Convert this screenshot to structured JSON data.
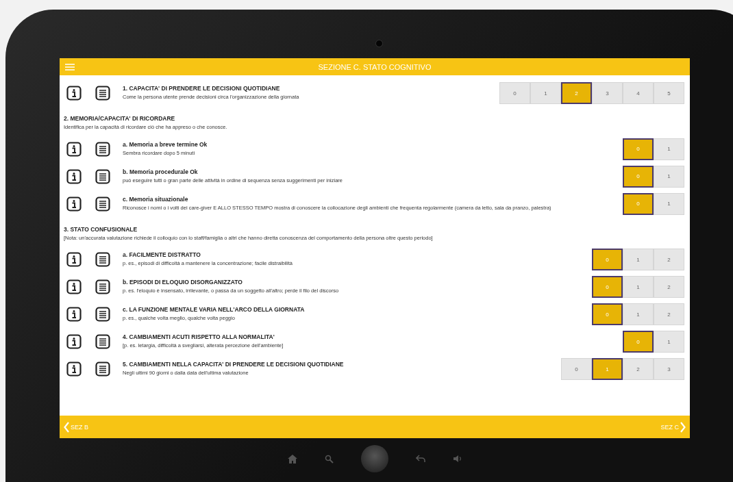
{
  "header": {
    "title": "SEZIONE C. STATO COGNITIVO"
  },
  "items": [
    {
      "kind": "question",
      "title": "1. CAPACITA' DI PRENDERE LE DECISIONI QUOTIDIANE",
      "description": "Come la persona utente prende decisioni circa l'organizzazione della giornata",
      "options": [
        {
          "label": "0",
          "selected": false
        },
        {
          "label": "1",
          "selected": false
        },
        {
          "label": "2",
          "selected": true
        },
        {
          "label": "3",
          "selected": false
        },
        {
          "label": "4",
          "selected": false
        },
        {
          "label": "5",
          "selected": false
        }
      ]
    },
    {
      "kind": "heading",
      "title": "2. MEMORIA/CAPACITA' DI RICORDARE",
      "description": "Identifica per la capacità di ricordare ciò che ha appreso o che conosce."
    },
    {
      "kind": "question",
      "title": "a. Memoria a breve termine Ok",
      "description": "Sembra ricordare dopo 5 minuti",
      "options": [
        {
          "label": "0",
          "selected": true
        },
        {
          "label": "1",
          "selected": false
        }
      ]
    },
    {
      "kind": "question",
      "title": "b. Memoria procedurale Ok",
      "description": "può eseguire tutti o gran parte delle attività in ordine di sequenza senza suggerimenti per iniziare",
      "options": [
        {
          "label": "0",
          "selected": true
        },
        {
          "label": "1",
          "selected": false
        }
      ]
    },
    {
      "kind": "question",
      "title": "c. Memoria situazionale",
      "description": "Riconosce i nomi o i volti dei care-giver E ALLO STESSO TEMPO mostra di conoscere la collocazione degli ambienti che frequenta regolarmente (camera da letto, sala da pranzo, palestra)",
      "options": [
        {
          "label": "0",
          "selected": true
        },
        {
          "label": "1",
          "selected": false
        }
      ]
    },
    {
      "kind": "heading",
      "title": "3. STATO CONFUSIONALE",
      "description": "[Nota: un'accurata valutazione richiede il colloquio con lo staff/famiglia o altri che hanno diretta conoscenza del comportamento della persona oltre questo periodo]"
    },
    {
      "kind": "question",
      "title": "a. FACILMENTE DISTRATTO",
      "description": "p. es., episodi di difficoltà a mantenere la concentrazione; facile distraibilità",
      "options": [
        {
          "label": "0",
          "selected": true
        },
        {
          "label": "1",
          "selected": false
        },
        {
          "label": "2",
          "selected": false
        }
      ]
    },
    {
      "kind": "question",
      "title": "b. EPISODI DI ELOQUIO DISORGANIZZATO",
      "description": "p. es. l'eloquio è insensato, irrilevante, o passa da un soggetto all'altro; perde il filo del discorso",
      "options": [
        {
          "label": "0",
          "selected": true
        },
        {
          "label": "1",
          "selected": false
        },
        {
          "label": "2",
          "selected": false
        }
      ]
    },
    {
      "kind": "question",
      "title": "c. LA FUNZIONE MENTALE VARIA NELL'ARCO DELLA GIORNATA",
      "description": "p. es., qualche volta meglio, qualche volta peggio",
      "options": [
        {
          "label": "0",
          "selected": true
        },
        {
          "label": "1",
          "selected": false
        },
        {
          "label": "2",
          "selected": false
        }
      ]
    },
    {
      "kind": "question",
      "title": "4. CAMBIAMENTI ACUTI RISPETTO ALLA NORMALITA'",
      "description": "[p. es. letargia, difficoltà a svegliarsi, alterata percezione dell'ambiente]",
      "options": [
        {
          "label": "0",
          "selected": true
        },
        {
          "label": "1",
          "selected": false
        }
      ]
    },
    {
      "kind": "question",
      "title": "5. CAMBIAMENTI NELLA CAPACITA' DI PRENDERE LE DECISIONI QUOTIDIANE",
      "description": "Negli ultimi 90 giorni o dalla data dell'ultima valutazione",
      "options": [
        {
          "label": "0",
          "selected": false
        },
        {
          "label": "1",
          "selected": true
        },
        {
          "label": "2",
          "selected": false
        },
        {
          "label": "3",
          "selected": false
        }
      ]
    }
  ],
  "footer": {
    "previous": "SEZ B",
    "next": "SEZ C"
  }
}
